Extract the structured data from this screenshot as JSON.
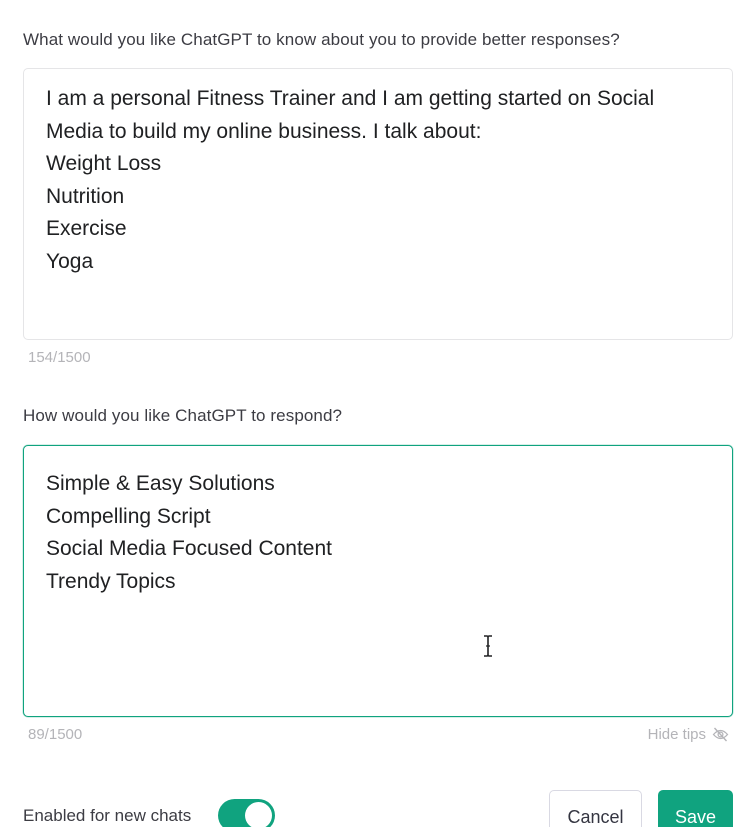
{
  "profile_section": {
    "question": "What would you like ChatGPT to know about you to provide better responses?",
    "lines": [
      "I am a personal Fitness Trainer and I am getting started on Social",
      "Media to build my online business. I talk about:",
      "Weight Loss",
      "Nutrition",
      "Exercise",
      "Yoga"
    ],
    "counter": "154/1500"
  },
  "response_section": {
    "question": "How would you like ChatGPT to respond?",
    "lines": [
      "Simple & Easy Solutions",
      "Compelling Script",
      "Social Media Focused Content",
      "Trendy Topics"
    ],
    "counter": "89/1500",
    "hide_tips_label": "Hide tips",
    "hide_tips_icon": "eye-off-icon"
  },
  "footer": {
    "toggle_label": "Enabled for new chats",
    "toggle_on": true,
    "cancel_label": "Cancel",
    "save_label": "Save"
  },
  "colors": {
    "accent": "#10a37f",
    "muted_text": "#b4b4b8",
    "border": "#e5e5e7"
  }
}
